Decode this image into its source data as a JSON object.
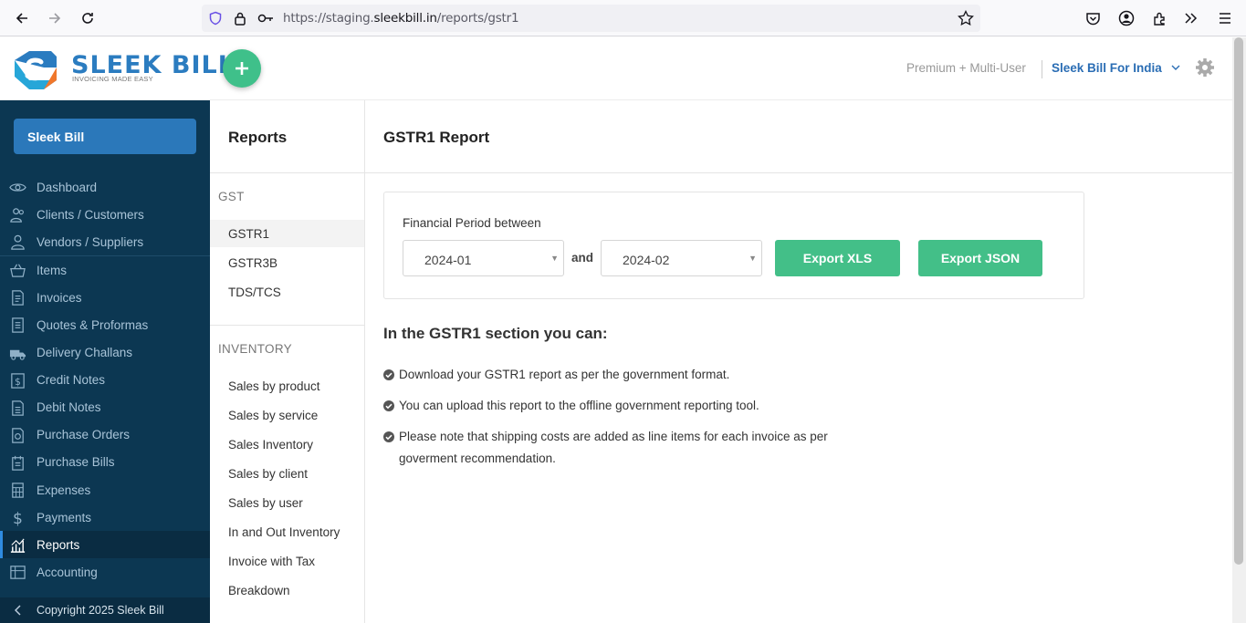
{
  "browser": {
    "url_prefix": "https://staging.",
    "url_host": "sleekbill.in",
    "url_path": "/reports/gstr1"
  },
  "header": {
    "logo_text": "SLEEK BILL",
    "logo_tagline": "INVOICING MADE EASY",
    "plan": "Premium + Multi-User",
    "company": "Sleek Bill For India",
    "accent_color": "#43bf88",
    "brand_color": "#2b7cc0"
  },
  "sidebar": {
    "org_button": "Sleek Bill",
    "items": [
      {
        "label": "Dashboard",
        "icon": "eye-icon"
      },
      {
        "label": "Clients / Customers",
        "icon": "users-icon"
      },
      {
        "label": "Vendors / Suppliers",
        "icon": "user-icon"
      },
      {
        "label": "Items",
        "icon": "basket-icon"
      },
      {
        "label": "Invoices",
        "icon": "invoice-icon"
      },
      {
        "label": "Quotes & Proformas",
        "icon": "document-icon"
      },
      {
        "label": "Delivery Challans",
        "icon": "truck-icon"
      },
      {
        "label": "Credit Notes",
        "icon": "dollar-doc-icon"
      },
      {
        "label": "Debit Notes",
        "icon": "debit-doc-icon"
      },
      {
        "label": "Purchase Orders",
        "icon": "purchase-order-icon"
      },
      {
        "label": "Purchase Bills",
        "icon": "bill-icon"
      },
      {
        "label": "Expenses",
        "icon": "calculator-icon"
      },
      {
        "label": "Payments",
        "icon": "dollar-icon"
      },
      {
        "label": "Reports",
        "icon": "chart-icon"
      },
      {
        "label": "Accounting",
        "icon": "ledger-icon"
      }
    ],
    "footer": "Copyright 2025 Sleek Bill"
  },
  "subnav": {
    "title": "Reports",
    "gst_group": "GST",
    "gst_items": [
      "GSTR1",
      "GSTR3B",
      "TDS/TCS"
    ],
    "inventory_group": "INVENTORY",
    "inventory_items": [
      "Sales by product",
      "Sales by service",
      "Sales Inventory",
      "Sales by client",
      "Sales by user",
      "In and Out Inventory",
      "Invoice with Tax",
      "Breakdown"
    ]
  },
  "main": {
    "title": "GSTR1 Report",
    "filter_label": "Financial Period between",
    "from_value": "2024-01",
    "and_text": "and",
    "to_value": "2024-02",
    "export_xls": "Export XLS",
    "export_json": "Export JSON",
    "info_title": "In the GSTR1 section you can:",
    "info_items": [
      "Download your GSTR1 report as per the government format.",
      "You can upload this report to the offline government reporting tool.",
      "Please note that shipping costs are added as line items for each invoice as per goverment recommendation."
    ]
  }
}
